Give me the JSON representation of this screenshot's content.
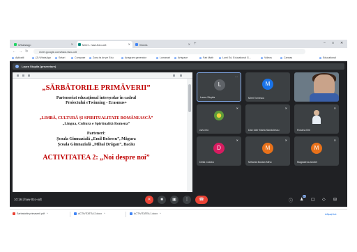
{
  "browser": {
    "tabs": [
      {
        "label": "WhatsApp",
        "fav": "#25d366",
        "active": false
      },
      {
        "label": "Meet - haw-ttzo-odt",
        "fav": "#00897b",
        "active": true
      },
      {
        "label": "Words",
        "fav": "#4285f4",
        "active": false
      }
    ],
    "url": "meet.google.com/haw-ttzo-odt",
    "bookmarks": [
      "Aplicatii",
      "(2) WhatsApp",
      "Setari",
      "Compose",
      "Zona ta de pe Edu",
      "Anagram generator",
      "Lumanari",
      "",
      "",
      "",
      "Artspace",
      "",
      "Fab Math",
      "Lumi Ed, Educational G...",
      "Videos",
      "Canvas",
      "Educational"
    ]
  },
  "meet": {
    "presenting_text": "Laura Stupila (prezentare)",
    "slide": {
      "line1": "„SĂRBĂTORILE PRIMĂVERII”",
      "line2": "Parteneriat educațional interșcolar în cadrul",
      "line3": "Proiectului eTwinning - Erasmus+",
      "line4": "„LIMBĂ, CULTURĂ ȘI SPIRITUALITATE ROMÂNEASCĂ”",
      "line5": "„Lingua, Cultura e Spiritualità Romena”",
      "line6": "Parteneri:",
      "line7": "Școala Gimnazială „Emil Brăescu”, Măgura",
      "line8": "Școala Gimnazială „Mihai Drăgan”, Bacău",
      "line9": "ACTIVITATEA 2: „Noi despre noi”"
    },
    "participants": [
      {
        "name": "Laura Stupila",
        "initial": "L",
        "color": "#5f6368",
        "type": "avatar",
        "speaking": true,
        "mute": "⋯"
      },
      {
        "name": "Mirel Tomescu",
        "initial": "M",
        "color": "#1a73e8",
        "type": "avatar",
        "speaking": false,
        "mute": ""
      },
      {
        "name": "",
        "initial": "",
        "color": "",
        "type": "video",
        "speaking": false,
        "mute": ""
      },
      {
        "name": "cws neo",
        "initial": "",
        "color": "",
        "type": "flower",
        "speaking": false,
        "mute": "🎤"
      },
      {
        "name": "Dan Ioler Marta Sandulescu",
        "initial": "",
        "color": "",
        "type": "blank",
        "speaking": false,
        "mute": "🎤"
      },
      {
        "name": "Roxana Bre",
        "initial": "",
        "color": "",
        "type": "bust",
        "speaking": false,
        "mute": "🎤"
      },
      {
        "name": "Delia Costea",
        "initial": "D",
        "color": "#d81b60",
        "type": "avatar",
        "speaking": false,
        "mute": "🎤"
      },
      {
        "name": "Mihaela Bostan Mihu",
        "initial": "M",
        "color": "#e8711a",
        "type": "avatar",
        "speaking": false,
        "mute": "🎤"
      },
      {
        "name": "Magdalena Andrei",
        "initial": "M",
        "color": "#e8711a",
        "type": "avatar",
        "speaking": false,
        "mute": "🎤"
      }
    ],
    "controls": {
      "time": "10:16",
      "meeting_code": "haw-ttzo-odt",
      "participants_count": "15"
    }
  },
  "taskbar": {
    "items": [
      {
        "label": "Sarbatorile primaverii.pdf",
        "ext": "",
        "color": "#ea4335"
      },
      {
        "label": "ACTIVITATEA 2.docx",
        "ext": "",
        "color": "#4285f4"
      },
      {
        "label": "ACTIVITATEA 1.docx",
        "ext": "",
        "color": "#4285f4"
      }
    ],
    "show_all": "Afișați tot"
  }
}
